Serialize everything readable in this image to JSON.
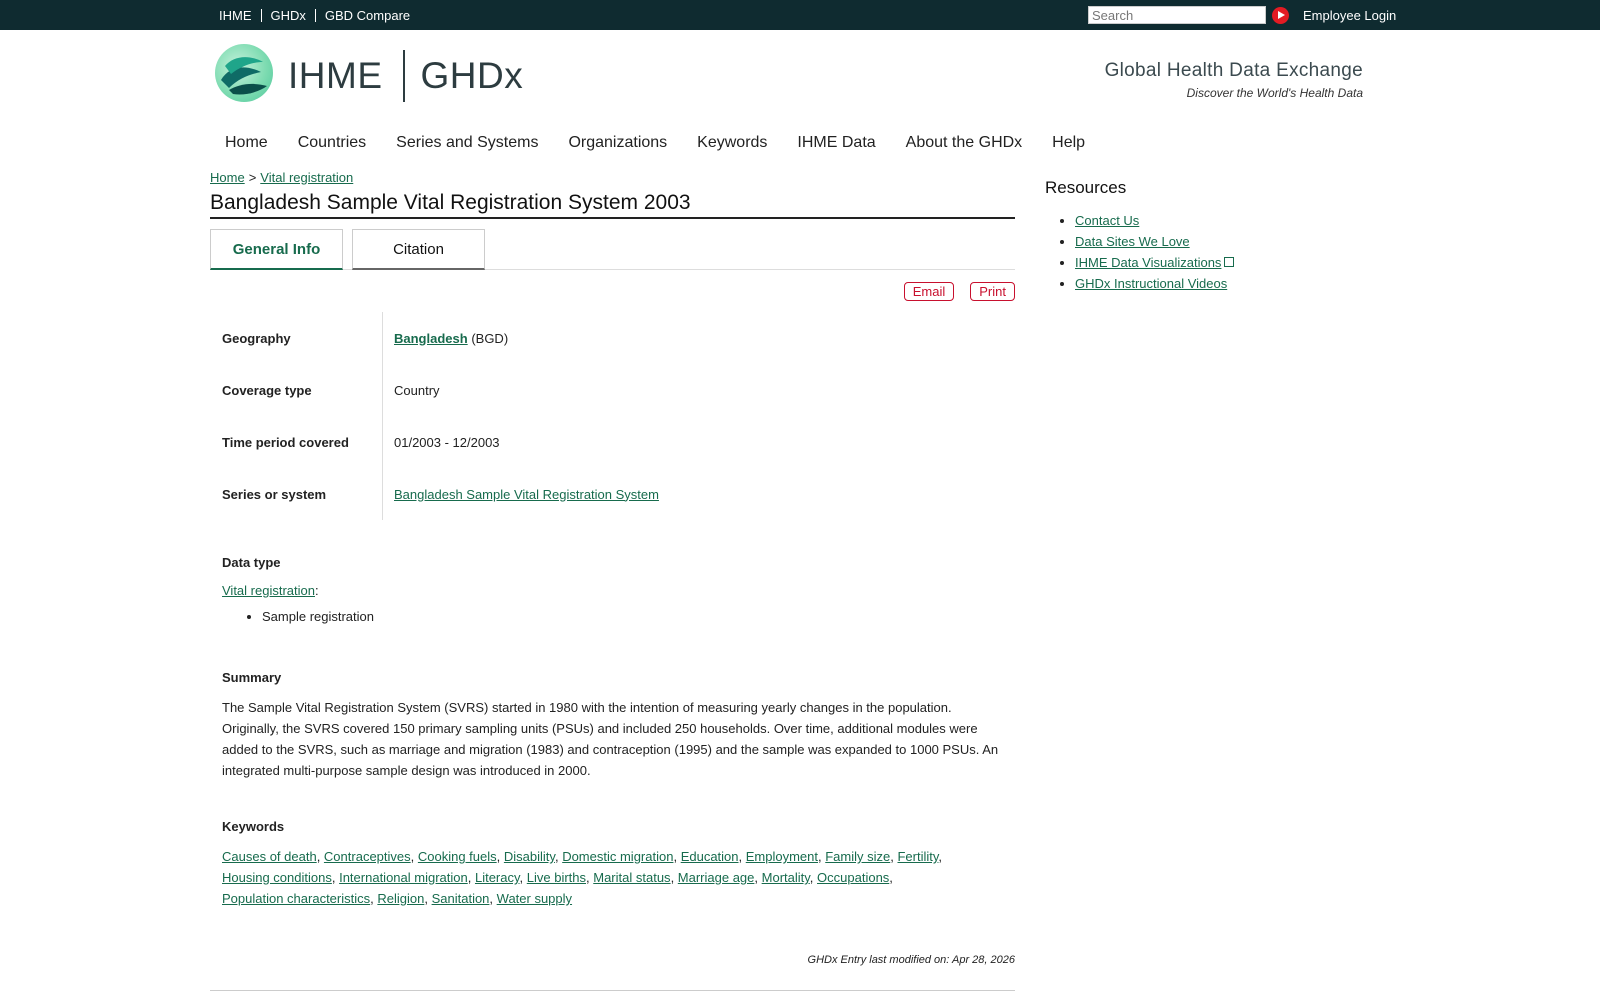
{
  "topbar": {
    "links": [
      "IHME",
      "GHDx",
      "GBD Compare"
    ],
    "search_placeholder": "Search",
    "login_label": "Employee Login"
  },
  "header": {
    "brand_left": "IHME",
    "brand_right": "GHDx",
    "tagline_title": "Global Health Data Exchange",
    "tagline_sub": "Discover the World's Health Data"
  },
  "nav": [
    "Home",
    "Countries",
    "Series and Systems",
    "Organizations",
    "Keywords",
    "IHME Data",
    "About the GHDx",
    "Help"
  ],
  "breadcrumb": {
    "home": "Home",
    "sep": ">",
    "current": "Vital registration"
  },
  "page_title": "Bangladesh Sample Vital Registration System 2003",
  "tabs": [
    "General Info",
    "Citation"
  ],
  "actions": {
    "email": "Email",
    "print": "Print"
  },
  "info": {
    "geography_label": "Geography",
    "geography_link": "Bangladesh",
    "geography_code": "(BGD)",
    "coverage_label": "Coverage type",
    "coverage_value": "Country",
    "time_label": "Time period covered",
    "time_value": "01/2003 - 12/2003",
    "series_label": "Series or system",
    "series_value": "Bangladesh Sample Vital Registration System"
  },
  "data_type": {
    "heading": "Data type",
    "link": "Vital registration",
    "colon": ":",
    "items": [
      "Sample registration"
    ]
  },
  "summary": {
    "heading": "Summary",
    "text": "The Sample Vital Registration System (SVRS) started in 1980 with the intention of measuring yearly changes in the population. Originally, the SVRS covered 150 primary sampling units (PSUs) and included 250 households. Over time, additional modules were added to the SVRS, such as marriage and migration (1983) and contraception (1995) and the sample was expanded to 1000 PSUs. An integrated multi-purpose sample design was introduced in 2000."
  },
  "keywords": {
    "heading": "Keywords",
    "items": [
      "Causes of death",
      "Contraceptives",
      "Cooking fuels",
      "Disability",
      "Domestic migration",
      "Education",
      "Employment",
      "Family size",
      "Fertility",
      "Housing conditions",
      "International migration",
      "Literacy",
      "Live births",
      "Marital status",
      "Marriage age",
      "Mortality",
      "Occupations",
      "Population characteristics",
      "Religion",
      "Sanitation",
      "Water supply"
    ]
  },
  "modified": "GHDx Entry last modified on: Apr 28, 2026",
  "sidebar": {
    "title": "Resources",
    "links": [
      "Contact Us",
      "Data Sites We Love",
      "IHME Data Visualizations",
      "GHDx Instructional Videos"
    ]
  },
  "colors": {
    "topbar": "#0f2b30",
    "link": "#176b4d",
    "accent_red": "#c8102e"
  }
}
